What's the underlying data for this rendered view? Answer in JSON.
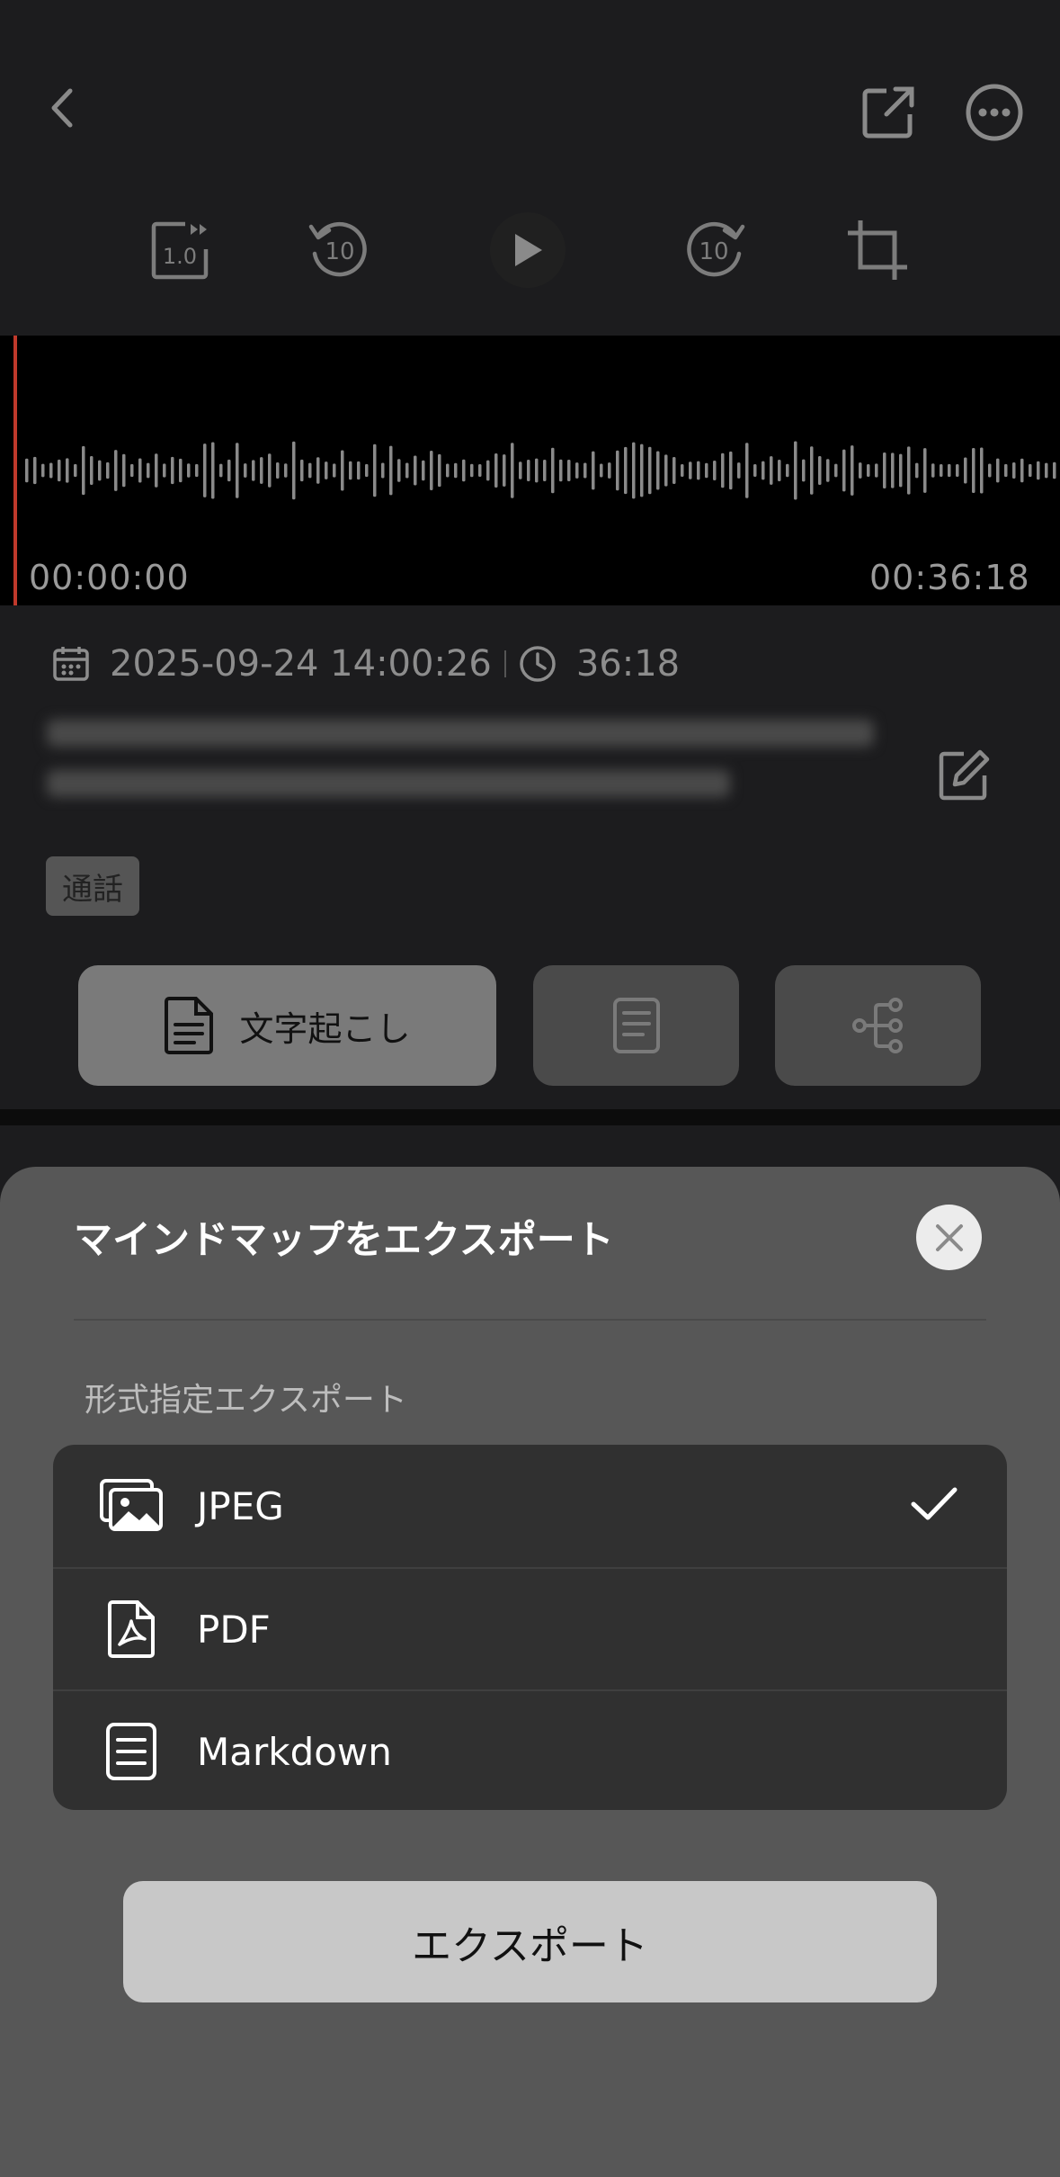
{
  "player": {
    "speed_label": "1.0",
    "rewind_label": "10",
    "forward_label": "10",
    "time_start": "00:00:00",
    "time_end": "00:36:18"
  },
  "recording": {
    "date": "2025-09-24 14:00:26",
    "duration": "36:18",
    "tag": "通話"
  },
  "tabs": {
    "primary_label": "文字起こし"
  },
  "sheet": {
    "title": "マインドマップをエクスポート",
    "section_label": "形式指定エクスポート",
    "options": [
      {
        "label": "JPEG",
        "icon": "image-icon",
        "selected": true
      },
      {
        "label": "PDF",
        "icon": "pdf-icon",
        "selected": false
      },
      {
        "label": "Markdown",
        "icon": "document-icon",
        "selected": false
      }
    ],
    "export_label": "エクスポート"
  },
  "colors": {
    "playhead": "#c0392b",
    "sheet_bg": "#575757",
    "button_bg": "#c8c8c8"
  }
}
